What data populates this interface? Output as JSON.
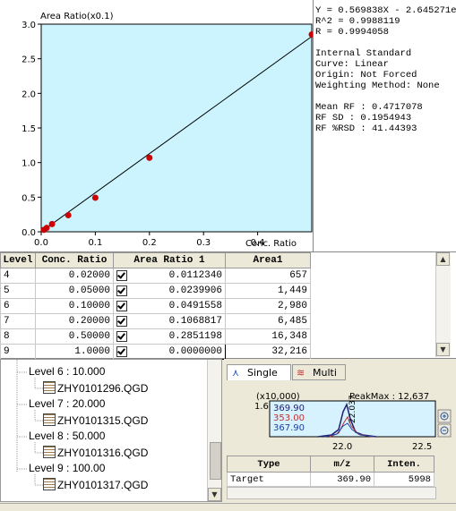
{
  "calibration_chart": {
    "title": "Area Ratio(x0.1)",
    "x_label": "Conc. Ratio",
    "chart_data": {
      "type": "scatter",
      "title": "Area Ratio(x0.1)",
      "xlabel": "Conc. Ratio",
      "ylabel": "Area Ratio(x0.1)",
      "xlim": [
        0.0,
        0.5
      ],
      "ylim": [
        0.0,
        3.0
      ],
      "x_ticks": [
        "0.0",
        "0.1",
        "0.2",
        "0.3",
        "0.4"
      ],
      "y_ticks": [
        "0.0",
        "0.5",
        "1.0",
        "1.5",
        "2.0",
        "2.5",
        "3.0"
      ],
      "grid": false,
      "points": [
        {
          "x": 0.005,
          "y": 0.028
        },
        {
          "x": 0.01,
          "y": 0.056
        },
        {
          "x": 0.02,
          "y": 0.112
        },
        {
          "x": 0.05,
          "y": 0.24
        },
        {
          "x": 0.1,
          "y": 0.492
        },
        {
          "x": 0.2,
          "y": 1.069
        },
        {
          "x": 0.5,
          "y": 2.851
        }
      ],
      "fit_line": {
        "x": [
          0.0,
          0.5
        ],
        "y": [
          -0.026,
          2.8225
        ]
      }
    }
  },
  "stats": [
    "Y = 0.569838X - 2.645271e",
    "R^2 = 0.9988119",
    "R = 0.9994058",
    "",
    "Internal Standard",
    "Curve: Linear",
    "Origin: Not Forced",
    "Weighting Method: None",
    "",
    "Mean RF :  0.4717078",
    "RF SD : 0.1954943",
    "RF %RSD : 41.44393"
  ],
  "level_table": {
    "headers": [
      "Level",
      "Conc. Ratio",
      "Area Ratio 1",
      "Area1"
    ],
    "rows": [
      {
        "level": "4",
        "conc": "0.02000",
        "ratio": "0.0112340",
        "area": "657"
      },
      {
        "level": "5",
        "conc": "0.05000",
        "ratio": "0.0239906",
        "area": "1,449"
      },
      {
        "level": "6",
        "conc": "0.10000",
        "ratio": "0.0491558",
        "area": "2,980"
      },
      {
        "level": "7",
        "conc": "0.20000",
        "ratio": "0.1068817",
        "area": "6,485"
      },
      {
        "level": "8",
        "conc": "0.50000",
        "ratio": "0.2851198",
        "area": "16,348"
      },
      {
        "level": "9",
        "conc": "1.0000",
        "ratio": "0.0000000",
        "area": "32,216"
      }
    ]
  },
  "tree": [
    {
      "level": "Level 6 : 10.000",
      "file": "ZHY0101296.QGD"
    },
    {
      "level": "Level 7 : 20.000",
      "file": "ZHY0101315.QGD"
    },
    {
      "level": "Level 8 : 50.000",
      "file": "ZHY0101316.QGD"
    },
    {
      "level": "Level 9 : 100.00",
      "file": "ZHY0101317.QGD"
    }
  ],
  "ms_panel": {
    "tabs": {
      "single": "Single",
      "multi": "Multi"
    },
    "multiplier": "(x10,000)",
    "peak_max": "PeakMax : 12,637",
    "y_max_label": "1.6",
    "mz_values": [
      {
        "mz": "369.90",
        "color": "#202070"
      },
      {
        "mz": "353.00",
        "color": "#c03030"
      },
      {
        "mz": "367.90",
        "color": "#2040a0"
      }
    ],
    "x_ticks": [
      "22.0",
      "22.5"
    ],
    "peak_label": "22.037",
    "table": {
      "headers": [
        "Type",
        "m/z",
        "Inten."
      ],
      "row": {
        "type": "Target",
        "mz": "369.90",
        "inten": "5998"
      }
    }
  },
  "colors": {
    "plot_bg": "#ccf4ff",
    "point": "#cc0000",
    "chrom_bg": "#d6f2ff"
  }
}
